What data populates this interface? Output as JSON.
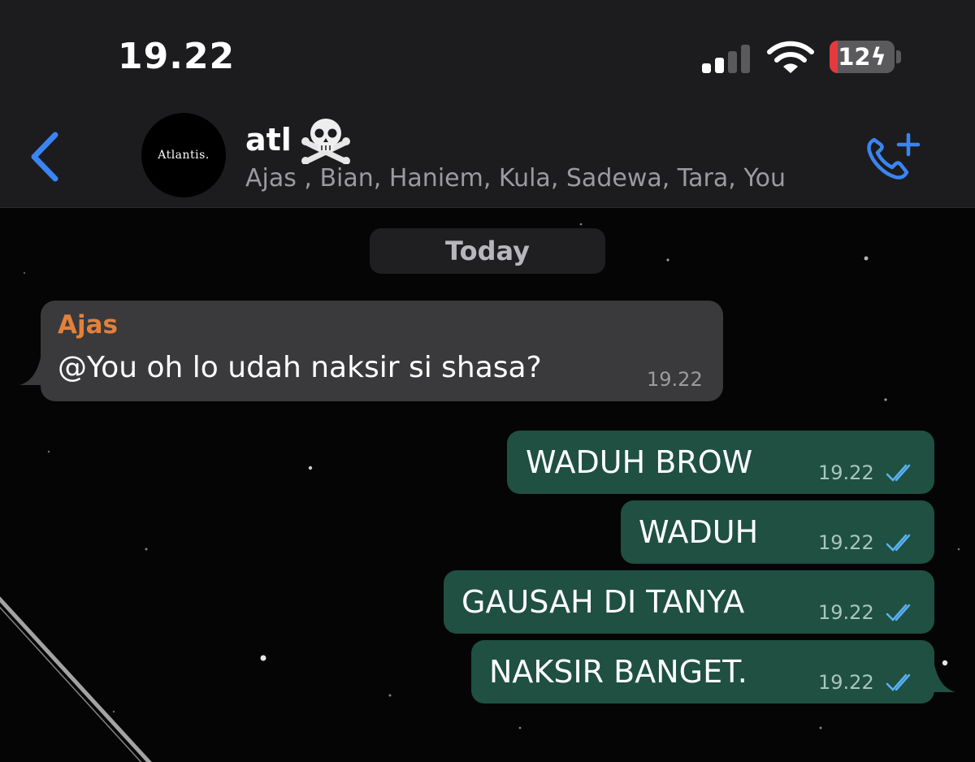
{
  "status_bar": {
    "time": "19.22",
    "battery": "12",
    "battery_level_percent": 12,
    "icons": [
      "signal-icon",
      "wifi-icon",
      "battery-charging-icon"
    ]
  },
  "header": {
    "back_icon": "chevron-left-icon",
    "avatar_text": "Atlantis.",
    "chat_name": "atl",
    "chat_emoji": "skull-and-crossbones-icon",
    "members": "Ajas , Bian, Haniem, Kula, Sadewa, Tara, You",
    "call_icon": "add-call-icon"
  },
  "chat": {
    "date_label": "Today",
    "incoming": {
      "sender": "Ajas",
      "text": "@You oh lo udah naksir si shasa?",
      "time": "19.22"
    },
    "outgoing": [
      {
        "text": "WADUH BROW",
        "time": "19.22",
        "status": "read"
      },
      {
        "text": "WADUH",
        "time": "19.22",
        "status": "read"
      },
      {
        "text": "GAUSAH DI TANYA",
        "time": "19.22",
        "status": "read"
      },
      {
        "text": "NAKSIR BANGET.",
        "time": "19.22",
        "status": "read"
      }
    ]
  },
  "colors": {
    "header_bg": "#1c1c1e",
    "accent_blue": "#3b84f3",
    "incoming_bubble": "#3a3a3c",
    "outgoing_bubble": "#1f5042",
    "sender_name": "#e3813a",
    "read_ticks": "#5ab0f5"
  }
}
